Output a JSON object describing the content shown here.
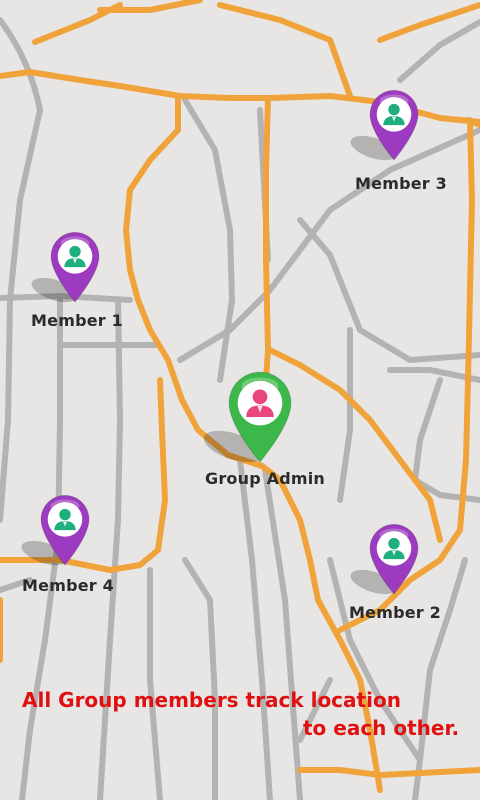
{
  "map": {
    "markers": [
      {
        "id": "member-3",
        "label": "Member 3",
        "role": "member"
      },
      {
        "id": "member-1",
        "label": "Member 1",
        "role": "member"
      },
      {
        "id": "group-admin",
        "label": "Group Admin",
        "role": "admin"
      },
      {
        "id": "member-4",
        "label": "Member 4",
        "role": "member"
      },
      {
        "id": "member-2",
        "label": "Member 2",
        "role": "member"
      }
    ],
    "colors": {
      "background": "#e8e6e4",
      "major_road": "#f0a33a",
      "minor_road": "#b3b3b3",
      "member_pin": "#9c3bbf",
      "admin_pin": "#3cb84a",
      "avatar_member": "#1fae7d",
      "avatar_admin": "#e8467c"
    }
  },
  "caption": {
    "line1": "All Group members track location",
    "line2": "to each other.",
    "color": "#e01010"
  }
}
